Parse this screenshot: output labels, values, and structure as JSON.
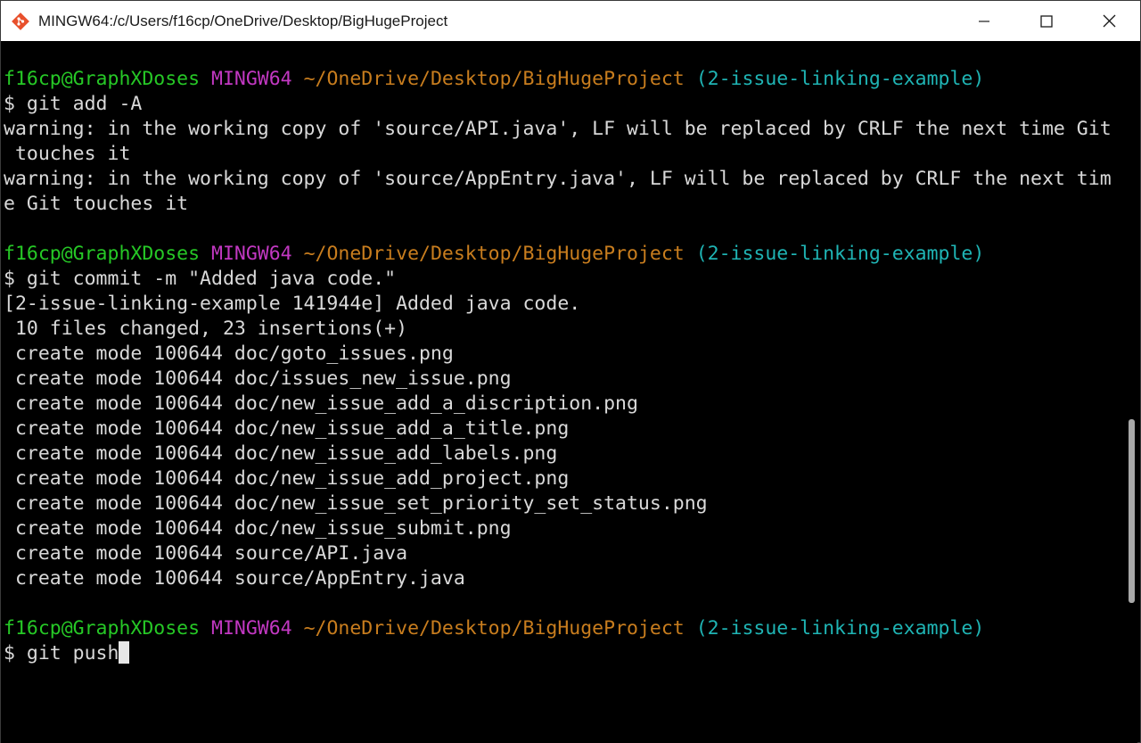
{
  "window": {
    "title": "MINGW64:/c/Users/f16cp/OneDrive/Desktop/BigHugeProject"
  },
  "controls": {
    "minimize": "minimize-icon",
    "maximize": "maximize-icon",
    "close": "close-icon"
  },
  "colors": {
    "user": "#26c826",
    "system": "#c238c2",
    "path": "#c87d1e",
    "branch": "#1fb4b4",
    "text": "#d9d9d9",
    "background": "#000000"
  },
  "prompt": {
    "user": "f16cp@GraphXDoses",
    "system": "MINGW64",
    "path": "~/OneDrive/Desktop/BigHugeProject",
    "branch": "(2-issue-linking-example)"
  },
  "lines": [
    {
      "kind": "blank",
      "text": ""
    },
    {
      "kind": "prompt"
    },
    {
      "kind": "text",
      "text": "$ git add -A"
    },
    {
      "kind": "text",
      "text": "warning: in the working copy of 'source/API.java', LF will be replaced by CRLF the next time Git"
    },
    {
      "kind": "text",
      "text": " touches it"
    },
    {
      "kind": "text",
      "text": "warning: in the working copy of 'source/AppEntry.java', LF will be replaced by CRLF the next tim"
    },
    {
      "kind": "text",
      "text": "e Git touches it"
    },
    {
      "kind": "blank",
      "text": ""
    },
    {
      "kind": "prompt"
    },
    {
      "kind": "text",
      "text": "$ git commit -m \"Added java code.\""
    },
    {
      "kind": "text",
      "text": "[2-issue-linking-example 141944e] Added java code."
    },
    {
      "kind": "text",
      "text": " 10 files changed, 23 insertions(+)"
    },
    {
      "kind": "text",
      "text": " create mode 100644 doc/goto_issues.png"
    },
    {
      "kind": "text",
      "text": " create mode 100644 doc/issues_new_issue.png"
    },
    {
      "kind": "text",
      "text": " create mode 100644 doc/new_issue_add_a_discription.png"
    },
    {
      "kind": "text",
      "text": " create mode 100644 doc/new_issue_add_a_title.png"
    },
    {
      "kind": "text",
      "text": " create mode 100644 doc/new_issue_add_labels.png"
    },
    {
      "kind": "text",
      "text": " create mode 100644 doc/new_issue_add_project.png"
    },
    {
      "kind": "text",
      "text": " create mode 100644 doc/new_issue_set_priority_set_status.png"
    },
    {
      "kind": "text",
      "text": " create mode 100644 doc/new_issue_submit.png"
    },
    {
      "kind": "text",
      "text": " create mode 100644 source/API.java"
    },
    {
      "kind": "text",
      "text": " create mode 100644 source/AppEntry.java"
    },
    {
      "kind": "blank",
      "text": ""
    },
    {
      "kind": "prompt"
    },
    {
      "kind": "input",
      "text": "$ git push"
    }
  ],
  "scrollbar": {
    "position": 0.74
  }
}
